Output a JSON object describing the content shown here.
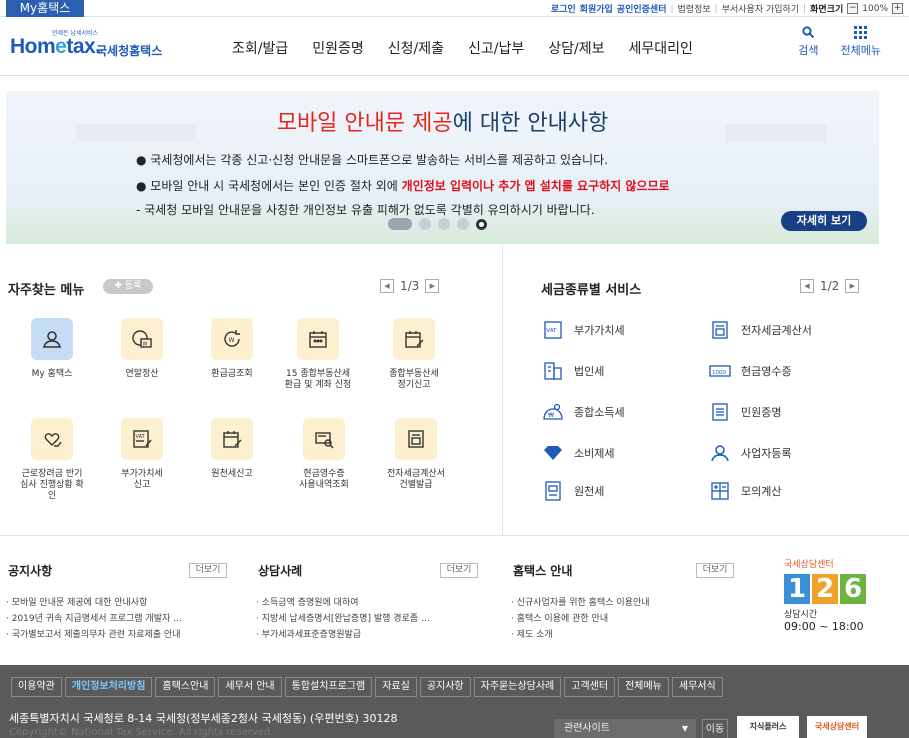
{
  "topbar": {
    "my_tab": "My홈택스",
    "login": "로그인",
    "signup": "회원가입",
    "cert_center": "공인인증센터",
    "law_info": "법령정보",
    "dept_user_join": "부서사용자 가입하기",
    "screen_size_label": "화면크기",
    "zoom_out": "−",
    "zoom_level": "100%",
    "zoom_in": "+"
  },
  "header": {
    "logo_small": "언제든 납세서비스",
    "logo_main_a": "Hom",
    "logo_main_e": "e",
    "logo_main_b": "tax",
    "logo_sub": "국세청홈택스",
    "nav": [
      "조회/발급",
      "민원증명",
      "신청/제출",
      "신고/납부",
      "상담/제보",
      "세무대리인"
    ],
    "search": "검색",
    "all_menu": "전체메뉴"
  },
  "banner": {
    "title_hl": "모바일 안내문 제공",
    "title_rest": "에 대한 안내사항",
    "line1": "● 국세청에서는 각종 신고·신청 안내문을 스마트폰으로 발송하는 서비스를 제공하고 있습니다.",
    "line2_a": "● 모바일 안내 시 국세청에서는 본인 인증 절차 외에 ",
    "line2_b": "개인정보 입력이나 추가 앱 설치를 요구하지 않으므로",
    "line3": "- 국세청 모바일 안내문을 사칭한 개인정보 유출 피해가 없도록 각별히 유의하시기 바랍니다.",
    "more": "자세히 보기"
  },
  "quick": {
    "title": "자주찾는 메뉴",
    "register": "✚ 등록",
    "page": "1/3",
    "items": [
      {
        "label": "My 홈택스",
        "icon": "person-icon"
      },
      {
        "label": "연말정산",
        "icon": "coin-card-icon"
      },
      {
        "label": "환급금조회",
        "icon": "refund-icon"
      },
      {
        "label": "15 종합부동산세\n환급 및 계좌 신청",
        "icon": "calendar-icon"
      },
      {
        "label": "종합부동산세\n정기신고",
        "icon": "calendar-pen-icon"
      },
      {
        "label": "근로장려금 반기\n심사 진행상황 확\n인",
        "icon": "heart-hand-icon"
      },
      {
        "label": "부가가치세\n신고",
        "icon": "vat-icon"
      },
      {
        "label": "원천세신고",
        "icon": "calendar-pen-icon"
      },
      {
        "label": "현금영수증\n사용내역조회",
        "icon": "receipt-search-icon"
      },
      {
        "label": "전자세금계산서\n건별발급",
        "icon": "invoice-icon"
      }
    ]
  },
  "tax_services": {
    "title": "세금종류별 서비스",
    "page": "1/2",
    "items": [
      {
        "label": "부가가치세",
        "icon": "vat-icon"
      },
      {
        "label": "전자세금계산서",
        "icon": "invoice-icon"
      },
      {
        "label": "법인세",
        "icon": "corporation-icon"
      },
      {
        "label": "현금영수증",
        "icon": "receipt-icon"
      },
      {
        "label": "종합소득세",
        "icon": "income-tax-icon"
      },
      {
        "label": "민원증명",
        "icon": "document-icon"
      },
      {
        "label": "소비제세",
        "icon": "diamond-icon"
      },
      {
        "label": "사업자등록",
        "icon": "person-icon"
      },
      {
        "label": "원천세",
        "icon": "withholding-icon"
      },
      {
        "label": "모의계산",
        "icon": "calculator-icon"
      }
    ]
  },
  "notices": {
    "title": "공지사항",
    "more": "더보기",
    "items": [
      "· 모바일 안내문 제공에 대한 안내사항",
      "· 2019년 귀속 지급명세서 프로그램 개발자 …",
      "· 국가별보고서 제출의무자 관련 자료제출 안내"
    ]
  },
  "cases": {
    "title": "상담사례",
    "more": "더보기",
    "items": [
      "· 소득금액 증명원에 대하여",
      "· 지방세 납세증명서[완납증명] 발행 경로좀 …",
      "· 부가세과세표준증명원발급"
    ]
  },
  "guide": {
    "title": "홈택스 안내",
    "more": "더보기",
    "items": [
      "· 신규사업자를 위한 홈택스 이용안내",
      "· 홈택스 이용에 관한 안내",
      "· 제도 소개"
    ]
  },
  "center": {
    "title": "국세상담센터",
    "digits": [
      "1",
      "2",
      "6"
    ],
    "hours_label": "상담시간",
    "hours": "09:00 ~ 18:00"
  },
  "footer": {
    "links": [
      "이용약관",
      "개인정보처리방침",
      "홈택스안내",
      "세무서 안내",
      "통합설치프로그램",
      "자료실",
      "공지사항",
      "자주묻는상담사례",
      "고객센터",
      "전체메뉴",
      "세무서식"
    ],
    "address": "세종특별자치시 국세청로 8-14 국세청(정부세종2청사 국세청동) (우편번호) 30128",
    "copyright": "Copyright© National Tax Service. All rights reserved.",
    "related_sites": "관련사이트",
    "go": "이동",
    "logo1": "지식플러스",
    "logo2": "국세상담센터"
  },
  "colors": {
    "brand_blue": "#1e5bb8",
    "accent_red": "#e8261d",
    "footer_bg": "#5a5a5a",
    "icon_yellow_bg": "#fdf0cf",
    "icon_blue_bg": "#c4ddf5"
  }
}
